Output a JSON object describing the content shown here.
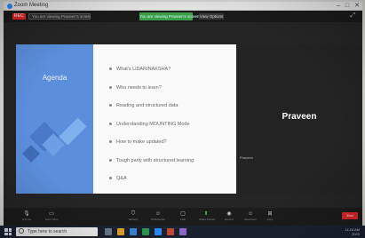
{
  "window": {
    "title": "Zoom Meeting",
    "controls": [
      "–",
      "□",
      "✕"
    ]
  },
  "meeting_bar": {
    "recording_label": "REC",
    "share_pill": "You are viewing Praveen's screen",
    "viewing_banner": "You are viewing Praveen's screen",
    "view_options": "View Options"
  },
  "slide": {
    "title": "Agenda",
    "items": [
      "What's LiDAR/NAKSHA?",
      "Who needs to learn?",
      "Reading and structured data",
      "Understanding MOUNTING Mode",
      "How to make updated?",
      "Tough party with structured learning",
      "Q&A"
    ]
  },
  "participant": {
    "name": "Praveen",
    "tag": "Praveen"
  },
  "toolbar": {
    "items": [
      {
        "icon": "mic-icon",
        "label": "Unmute"
      },
      {
        "icon": "video-icon",
        "label": "Start Video"
      },
      {
        "icon": "security-icon",
        "label": "Security"
      },
      {
        "icon": "participants-icon",
        "label": "Participants"
      },
      {
        "icon": "chat-icon",
        "label": "Chat"
      },
      {
        "icon": "share-screen-icon",
        "label": "Share Screen"
      },
      {
        "icon": "record-icon",
        "label": "Record"
      },
      {
        "icon": "reactions-icon",
        "label": "Reactions"
      },
      {
        "icon": "apps-icon",
        "label": "Apps"
      }
    ],
    "end_label": "End"
  },
  "taskbar": {
    "search_placeholder": "Type here to search",
    "time": "11:24 AM",
    "date": "2023"
  },
  "colors": {
    "slide_accent": "#5b8fdc",
    "end_button": "#e02828",
    "viewing_banner": "#3b9e48",
    "taskbar": "#1b2230"
  }
}
